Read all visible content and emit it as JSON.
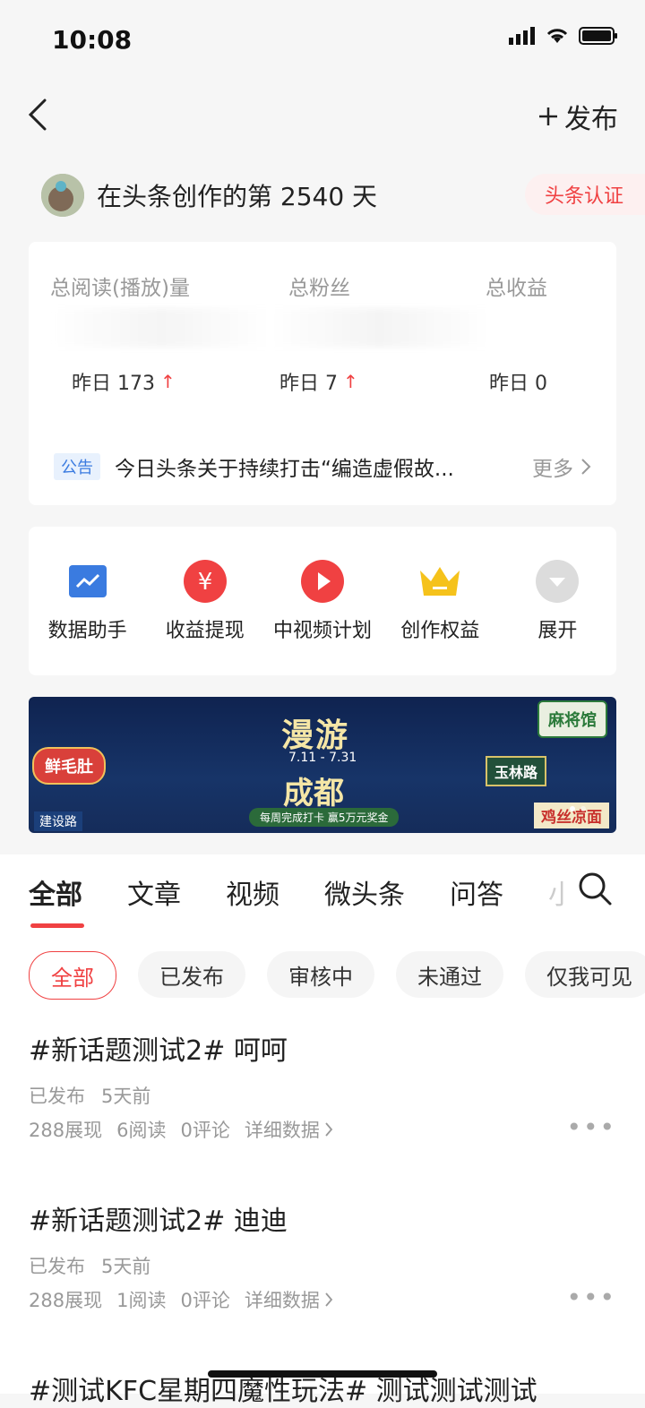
{
  "status_bar": {
    "time": "10:08"
  },
  "nav": {
    "publish_label": "发布"
  },
  "profile": {
    "creator_days": "在头条创作的第 2540 天",
    "verify_label": "头条认证"
  },
  "stats": {
    "items": [
      {
        "label": "总阅读(播放)量",
        "yesterday": "昨日 173"
      },
      {
        "label": "总粉丝",
        "yesterday": "昨日 7"
      },
      {
        "label": "总收益",
        "yesterday": "昨日 0"
      }
    ]
  },
  "notice": {
    "tag": "公告",
    "text": "今日头条关于持续打击“编造虚假故...",
    "more": "更多"
  },
  "tools": [
    {
      "label": "数据助手",
      "icon": "chart-icon",
      "color": "#3a7be0"
    },
    {
      "label": "收益提现",
      "icon": "yuan-icon",
      "color": "#f04142"
    },
    {
      "label": "中视频计划",
      "icon": "play-icon",
      "color": "#f04142"
    },
    {
      "label": "创作权益",
      "icon": "crown-icon",
      "color": "#f5c21b"
    },
    {
      "label": "展开",
      "icon": "expand-icon",
      "color": "#dcdcdc"
    }
  ],
  "banner": {
    "title": "漫游",
    "date": "7.11 - 7.31",
    "subtitle": "成都",
    "cta": "每周完成打卡 赢5万元奖金",
    "tag_left": "鲜毛肚",
    "tag_right": "麻将馆",
    "road_left": "建设路",
    "road_right": "玉林路",
    "sign_right": "鸡丝凉面"
  },
  "tabs": [
    "全部",
    "文章",
    "视频",
    "微头条",
    "问答",
    "小"
  ],
  "filters": [
    "全部",
    "已发布",
    "审核中",
    "未通过",
    "仅我可见"
  ],
  "posts": [
    {
      "title": "#新话题测试2# 呵呵",
      "status": "已发布",
      "time": "5天前",
      "impressions": "288展现",
      "reads": "6阅读",
      "comments": "0评论",
      "detail": "详细数据"
    },
    {
      "title": "#新话题测试2# 迪迪",
      "status": "已发布",
      "time": "5天前",
      "impressions": "288展现",
      "reads": "1阅读",
      "comments": "0评论",
      "detail": "详细数据"
    },
    {
      "title": "#测试KFC星期四魔性玩法# 测试测试测试"
    }
  ]
}
